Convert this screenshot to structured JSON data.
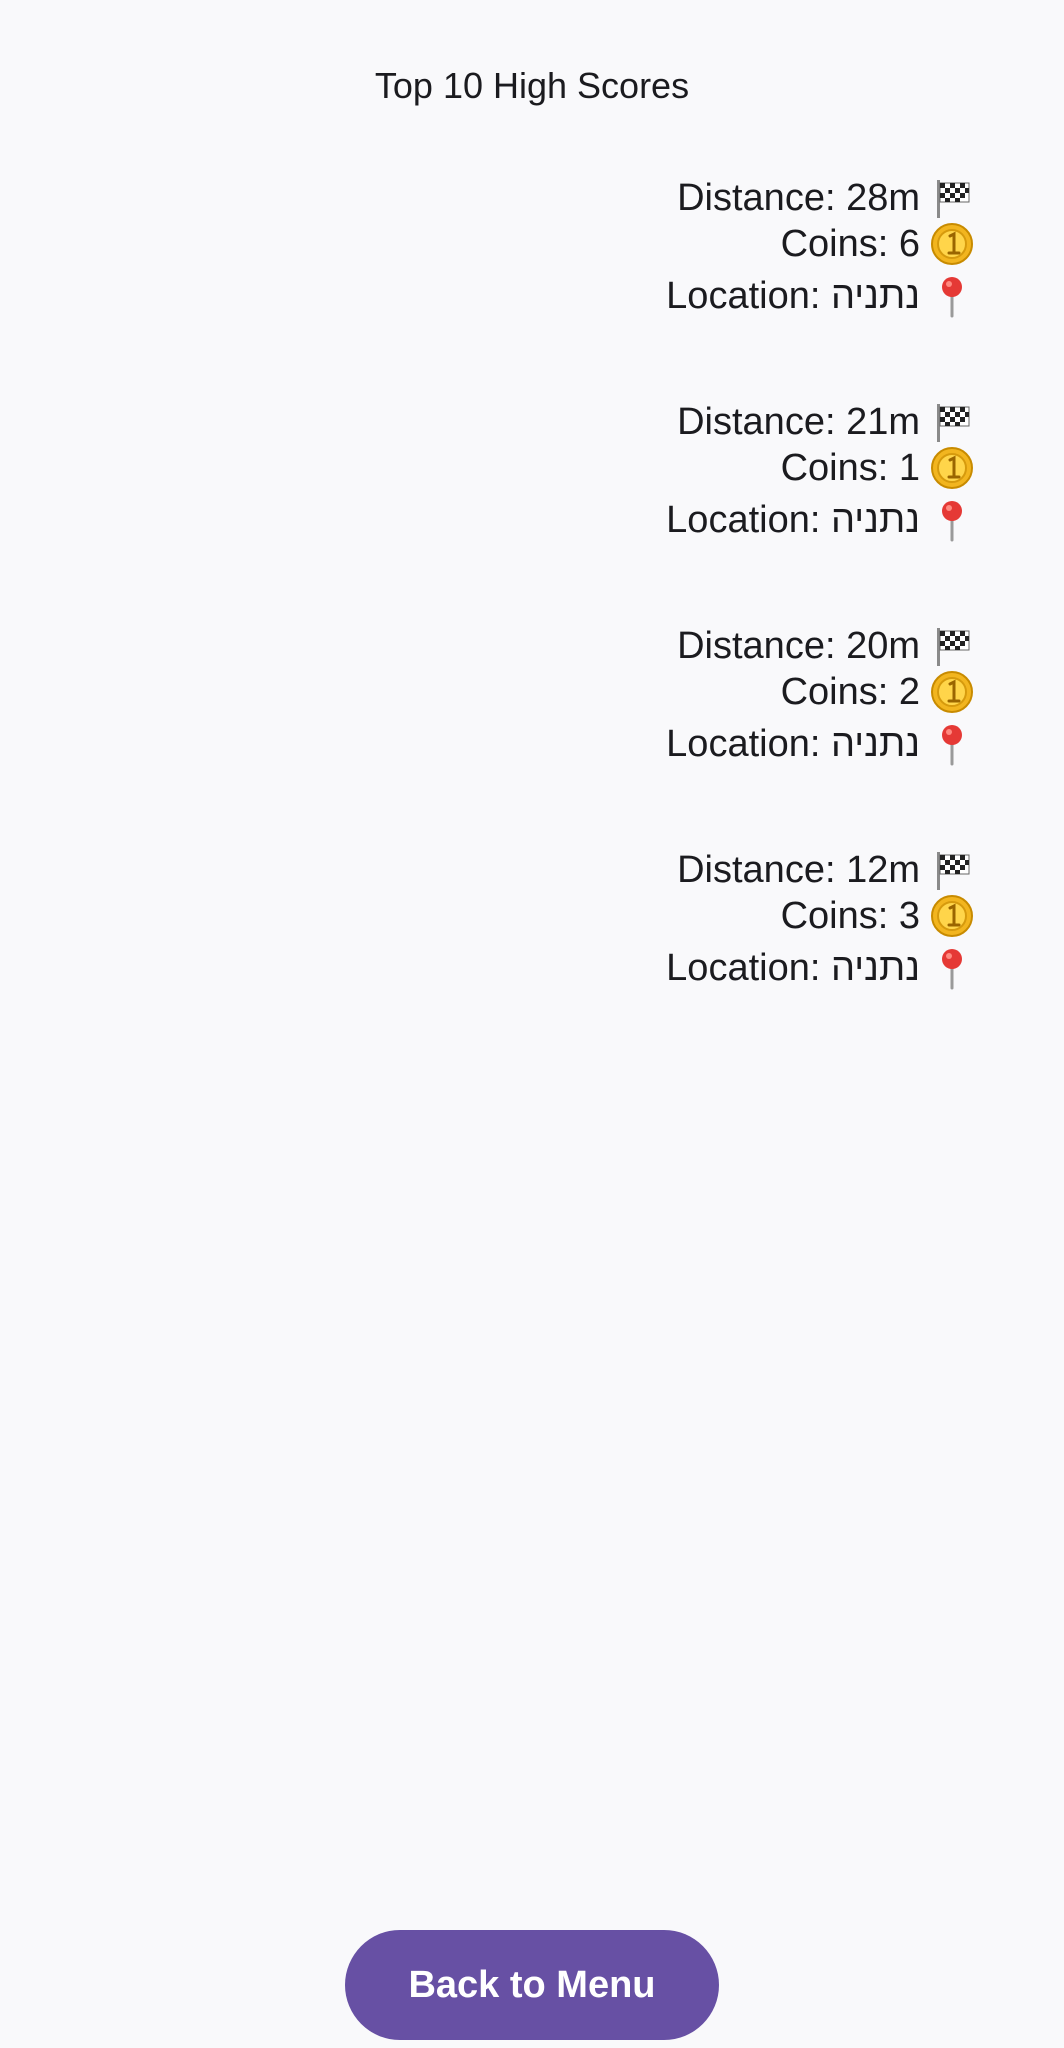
{
  "header": {
    "title": "Top 10 High Scores"
  },
  "scores": [
    {
      "distance": "Distance: 28m",
      "coins": "Coins: 6",
      "location": "Location: נתניה"
    },
    {
      "distance": "Distance: 21m",
      "coins": "Coins: 1",
      "location": "Location: נתניה"
    },
    {
      "distance": "Distance: 20m",
      "coins": "Coins: 2",
      "location": "Location: נתניה"
    },
    {
      "distance": "Distance: 12m",
      "coins": "Coins: 3",
      "location": "Location: נתניה"
    }
  ],
  "icons": {
    "distance": "checkered-flag-icon",
    "coins": "coin-icon",
    "location": "map-pin-icon"
  },
  "footer": {
    "back_label": "Back to Menu"
  },
  "colors": {
    "background": "#f9f9fb",
    "accent": "#6750a4"
  }
}
